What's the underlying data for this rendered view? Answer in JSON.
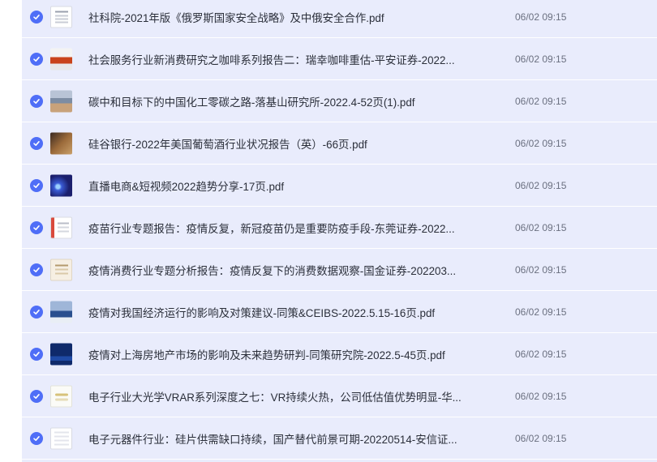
{
  "files": [
    {
      "name": "社科院-2021年版《俄罗斯国家安全战略》及中俄安全合作.pdf",
      "time": "06/02 09:15",
      "thumb": "t-doc",
      "icon": "pdf-thumbnail-icon"
    },
    {
      "name": "社会服务行业新消费研究之咖啡系列报告二：瑞幸咖啡重估-平安证券-2022...",
      "time": "06/02 09:15",
      "thumb": "t-coffee",
      "icon": "pdf-thumbnail-icon"
    },
    {
      "name": "碳中和目标下的中国化工零碳之路-落基山研究所-2022.4-52页(1).pdf",
      "time": "06/02 09:15",
      "thumb": "t-city",
      "icon": "pdf-thumbnail-icon"
    },
    {
      "name": "硅谷银行-2022年美国葡萄酒行业状况报告（英）-66页.pdf",
      "time": "06/02 09:15",
      "thumb": "t-wine",
      "icon": "pdf-thumbnail-icon"
    },
    {
      "name": "直播电商&短视频2022趋势分享-17页.pdf",
      "time": "06/02 09:15",
      "thumb": "t-live",
      "icon": "pdf-thumbnail-icon"
    },
    {
      "name": "疫苗行业专题报告：疫情反复，新冠疫苗仍是重要防疫手段-东莞证券-2022...",
      "time": "06/02 09:15",
      "thumb": "t-red",
      "icon": "pdf-thumbnail-icon"
    },
    {
      "name": "疫情消费行业专题分析报告：疫情反复下的消费数据观察-国金证券-202203...",
      "time": "06/02 09:15",
      "thumb": "t-tan",
      "icon": "pdf-thumbnail-icon"
    },
    {
      "name": "疫情对我国经济运行的影响及对策建议-同策&CEIBS-2022.5.15-16页.pdf",
      "time": "06/02 09:15",
      "thumb": "t-sea",
      "icon": "pdf-thumbnail-icon"
    },
    {
      "name": "疫情对上海房地产市场的影响及未来趋势研判-同策研究院-2022.5-45页.pdf",
      "time": "06/02 09:15",
      "thumb": "t-navy",
      "icon": "pdf-thumbnail-icon"
    },
    {
      "name": "电子行业大光学VRAR系列深度之七：VR持续火热，公司低估值优势明显-华...",
      "time": "06/02 09:15",
      "thumb": "t-wave",
      "icon": "pdf-thumbnail-icon"
    },
    {
      "name": "电子元器件行业：硅片供需缺口持续，国产替代前景可期-20220514-安信证...",
      "time": "06/02 09:15",
      "thumb": "t-grid",
      "icon": "pdf-thumbnail-icon"
    }
  ],
  "colors": {
    "accent": "#4f6ef7",
    "row_bg": "#e9ecfc"
  },
  "check_icon": "checkmark-circle-icon"
}
